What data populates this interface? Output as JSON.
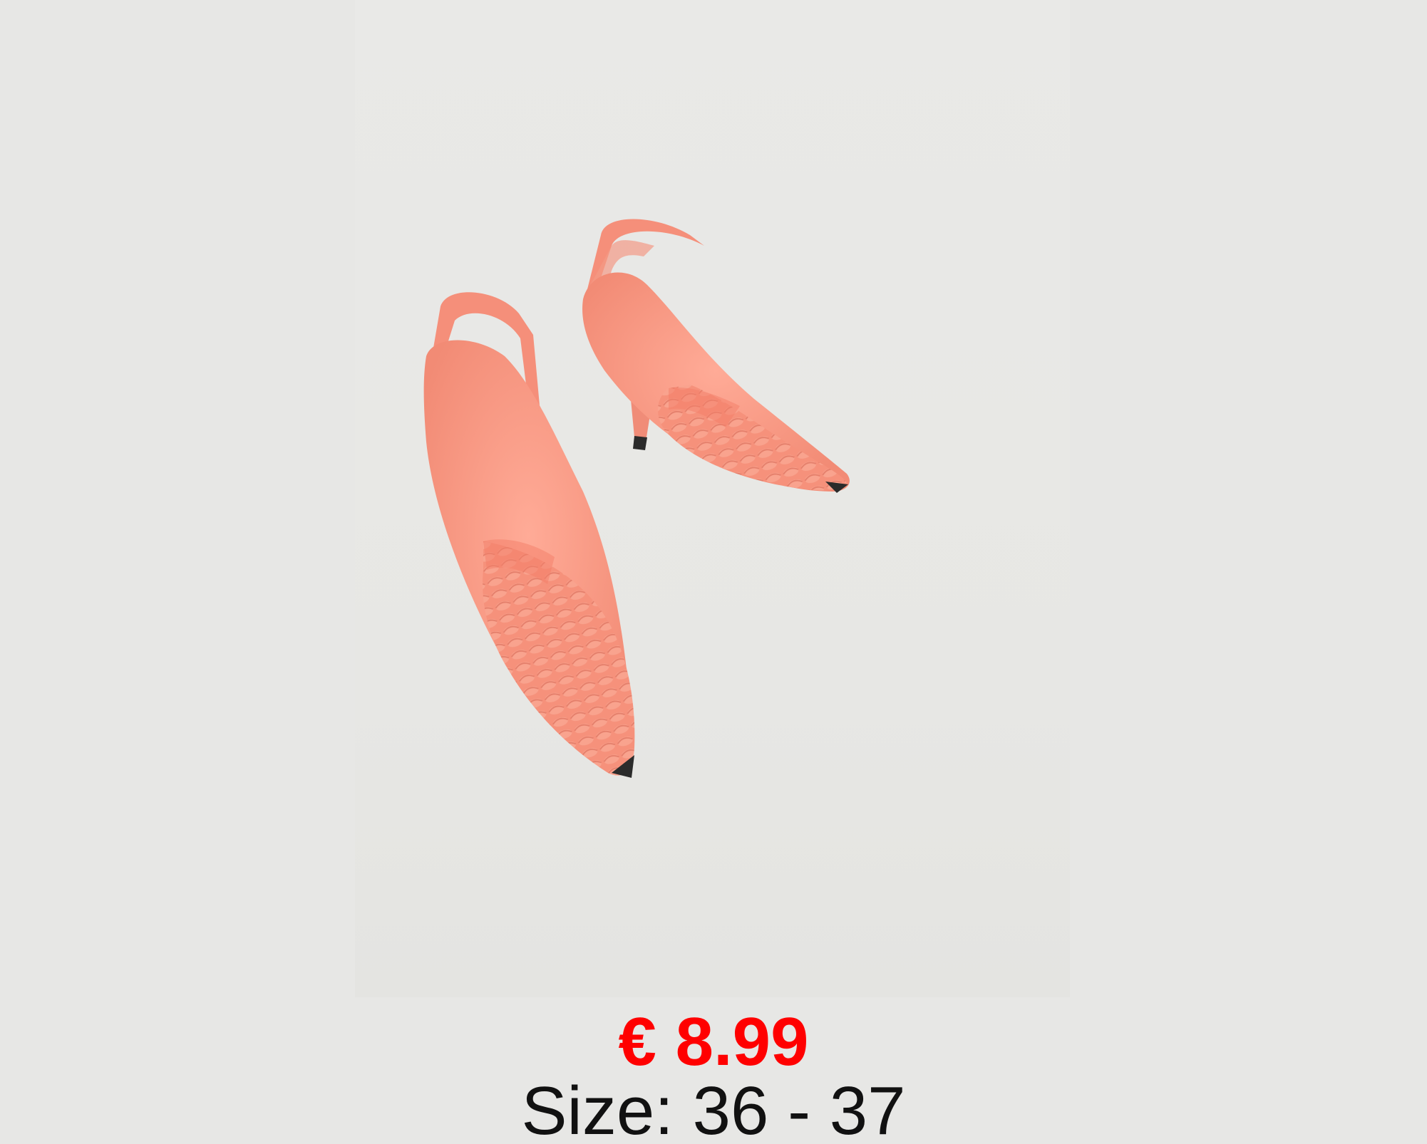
{
  "product": {
    "image_icon": "coral-woven-slingback-heels",
    "price": "€ 8.99",
    "size": "Size: 36 - 37"
  },
  "colors": {
    "background": "#e7e7e5",
    "price": "#ff0000",
    "text": "#111111",
    "shoe": "#f7957f"
  }
}
